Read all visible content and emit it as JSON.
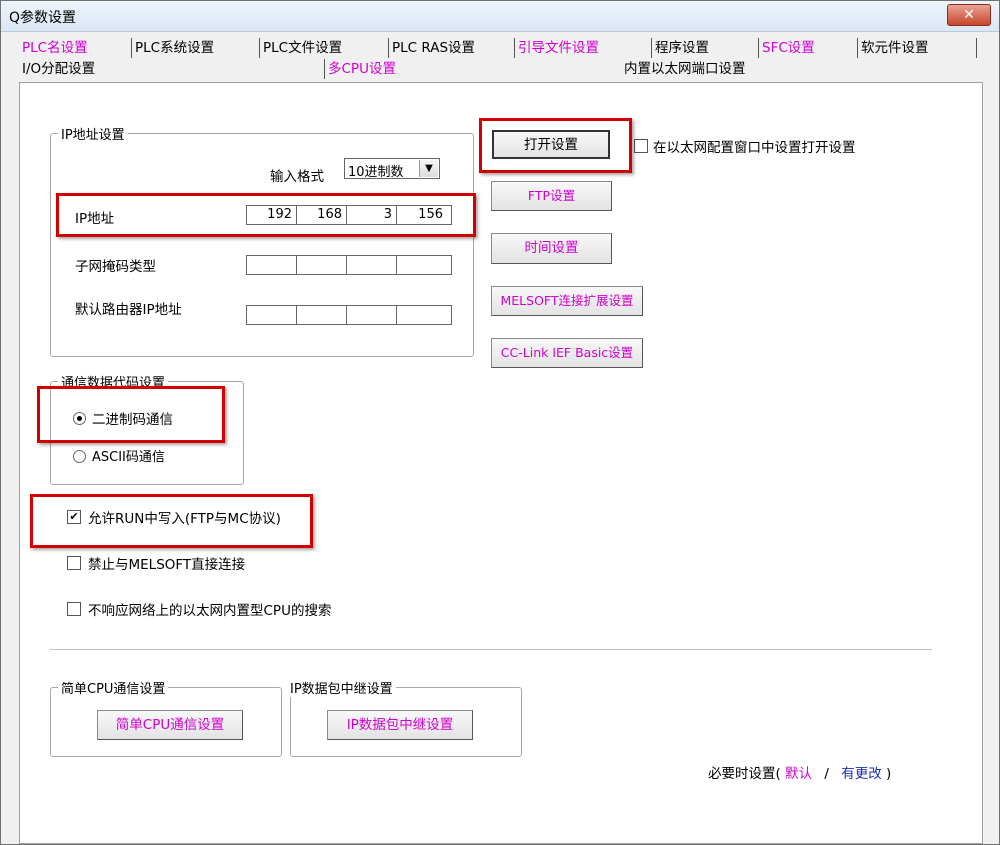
{
  "window": {
    "title": "Q参数设置",
    "close_label": "✕"
  },
  "tabs_row1": [
    {
      "label": "PLC名设置",
      "color": "#d000d0"
    },
    {
      "label": "PLC系统设置",
      "color": "#000000"
    },
    {
      "label": "PLC文件设置",
      "color": "#000000"
    },
    {
      "label": "PLC RAS设置",
      "color": "#000000"
    },
    {
      "label": "引导文件设置",
      "color": "#d000d0"
    },
    {
      "label": "程序设置",
      "color": "#000000"
    },
    {
      "label": "SFC设置",
      "color": "#d000d0"
    },
    {
      "label": "软元件设置",
      "color": "#000000"
    }
  ],
  "tabs_row2": [
    {
      "label": "I/O分配设置",
      "color": "#000000"
    },
    {
      "label": "多CPU设置",
      "color": "#d000d0"
    },
    {
      "label": "内置以太网端口设置",
      "color": "#000000",
      "active": true
    }
  ],
  "ip_group": {
    "title": "IP地址设置",
    "input_format_label": "输入格式",
    "input_format_value": "10进制数",
    "ip_label": "IP地址",
    "ip_value": [
      "192",
      "168",
      "3",
      "156"
    ],
    "subnet_label": "子网掩码类型",
    "subnet_value": [
      "",
      "",
      "",
      ""
    ],
    "gateway_label": "默认路由器IP地址",
    "gateway_value": [
      "",
      "",
      "",
      ""
    ]
  },
  "buttons": {
    "open_settings": "打开设置",
    "open_in_ethernet_config": "在以太网配置窗口中设置打开设置",
    "ftp": "FTP设置",
    "time": "时间设置",
    "melsoft_ext": "MELSOFT连接扩展设置",
    "cclink": "CC-Link IEF Basic设置"
  },
  "comm_code_group": {
    "title": "通信数据代码设置",
    "binary_label": "二进制码通信",
    "ascii_label": "ASCII码通信",
    "selected": "binary"
  },
  "options": {
    "allow_run_write": {
      "label": "允许RUN中写入(FTP与MC协议)",
      "checked": true
    },
    "disable_melsoft_direct": {
      "label": "禁止与MELSOFT直接连接",
      "checked": false
    },
    "no_response_search": {
      "label": "不响应网络上的以太网内置型CPU的搜索",
      "checked": false
    }
  },
  "simple_cpu_group": {
    "title": "简单CPU通信设置",
    "button": "简单CPU通信设置"
  },
  "ip_relay_group": {
    "title": "IP数据包中继设置",
    "button": "IP数据包中继设置"
  },
  "footer": {
    "prefix": "必要时设置(",
    "default_label": "默认",
    "separator": "/",
    "changed_label": "有更改",
    "suffix": ")"
  },
  "colors": {
    "highlight_box": "#d40000",
    "setting_text": "#d000d0",
    "changed_text": "#1a2fb5"
  }
}
